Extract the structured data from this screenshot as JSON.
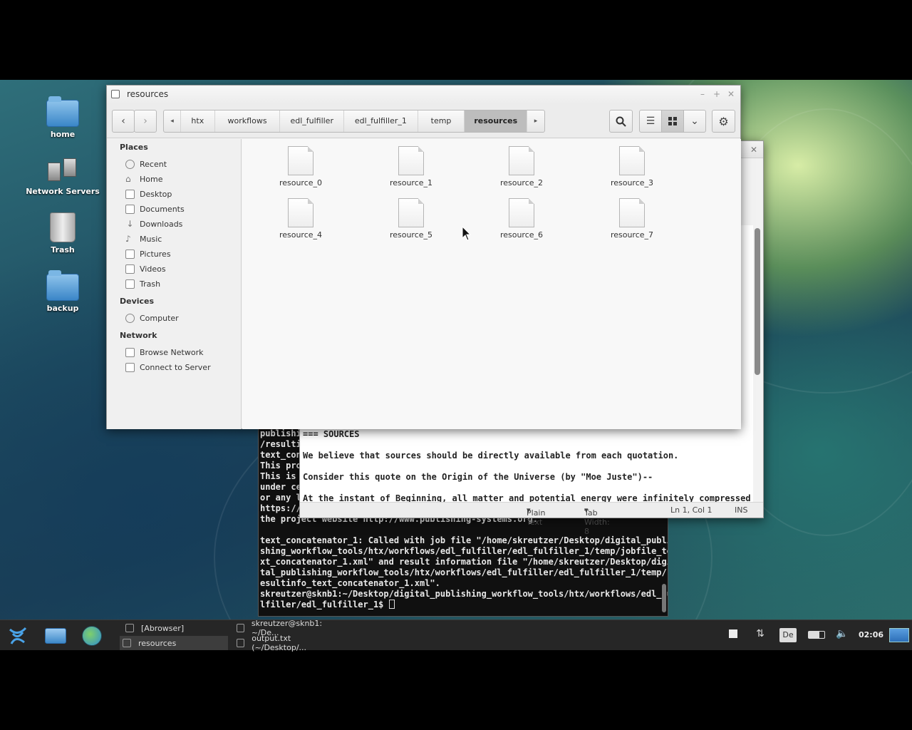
{
  "desktop": {
    "icons": [
      {
        "label": "home"
      },
      {
        "label": "Network Servers"
      },
      {
        "label": "Trash"
      },
      {
        "label": "backup"
      }
    ]
  },
  "file_manager": {
    "title": "resources",
    "breadcrumbs": [
      "htx",
      "workflows",
      "edl_fulfiller",
      "edl_fulfiller_1",
      "temp",
      "resources"
    ],
    "active_crumb": "resources",
    "sidebar": {
      "places_header": "Places",
      "places": [
        "Recent",
        "Home",
        "Desktop",
        "Documents",
        "Downloads",
        "Music",
        "Pictures",
        "Videos",
        "Trash"
      ],
      "devices_header": "Devices",
      "devices": [
        "Computer"
      ],
      "network_header": "Network",
      "network": [
        "Browse Network",
        "Connect to Server"
      ]
    },
    "files": [
      "resource_0",
      "resource_1",
      "resource_2",
      "resource_3",
      "resource_4",
      "resource_5",
      "resource_6",
      "resource_7"
    ]
  },
  "editor": {
    "lines": [
      "=== SOURCES",
      "",
      "We believe that sources should be directly available from each quotation.",
      "",
      "Consider this quote on the Origin of the Universe (by \"Moe Juste\")--",
      "",
      "At the instant of Beginning, all matter and potential energy were infinitely compressed"
    ],
    "status": {
      "language": "Plain Text",
      "tab_width": "Tab Width: 8",
      "position": "Ln 1, Col 1",
      "mode": "INS"
    }
  },
  "terminal": {
    "lines": [
      "publishi",
      "/resulti",
      "text_con",
      "This pro",
      "This is ",
      "under ce",
      "or any l",
      "https://",
      "the project website http://www.publishing-systems.org.",
      "",
      "text_concatenator_1: Called with job file \"/home/skreutzer/Desktop/digital_publi",
      "shing_workflow_tools/htx/workflows/edl_fulfiller/edl_fulfiller_1/temp/jobfile_te",
      "xt_concatenator_1.xml\" and result information file \"/home/skreutzer/Desktop/digi",
      "tal_publishing_workflow_tools/htx/workflows/edl_fulfiller/edl_fulfiller_1/temp/r",
      "esultinfo_text_concatenator_1.xml\".",
      "skreutzer@sknb1:~/Desktop/digital_publishing_workflow_tools/htx/workflows/edl_fu",
      "lfiller/edl_fulfiller_1$ "
    ]
  },
  "taskbar": {
    "tasks": [
      {
        "label": "[Abrowser]"
      },
      {
        "label": "skreutzer@sknb1: ~/De..."
      },
      {
        "label": "resources"
      },
      {
        "label": "output.txt (~/Desktop/..."
      }
    ],
    "keyboard_layout": "De",
    "clock": "02:06"
  }
}
